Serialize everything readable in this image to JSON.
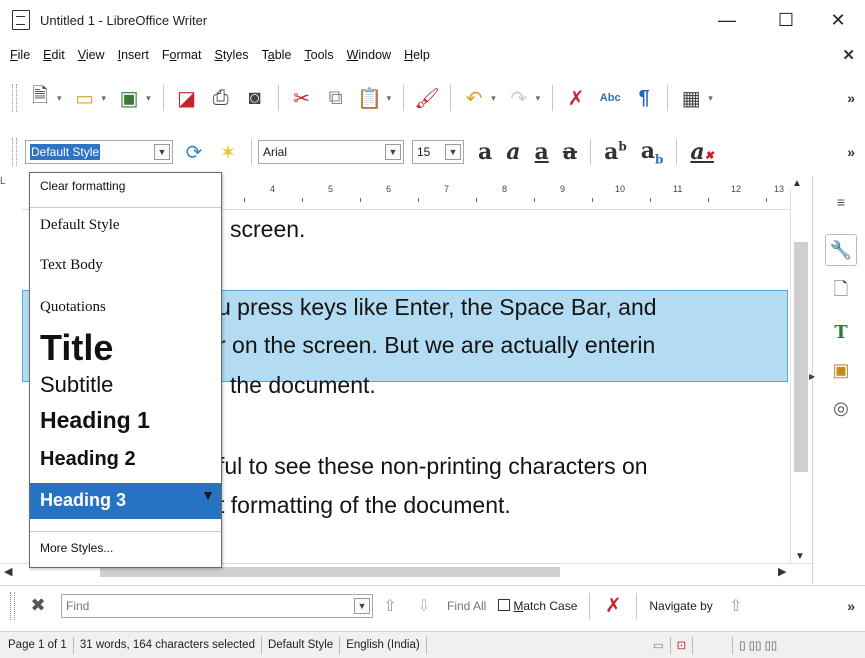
{
  "window": {
    "title": "Untitled 1 - LibreOffice Writer",
    "minimize": "—",
    "maximize": "☐",
    "close": "✕"
  },
  "menu": {
    "items": [
      {
        "u": "F",
        "rest": "ile"
      },
      {
        "u": "E",
        "rest": "dit"
      },
      {
        "u": "V",
        "rest": "iew"
      },
      {
        "u": "I",
        "rest": "nsert"
      },
      {
        "pre": "F",
        "u": "o",
        "rest": "rmat"
      },
      {
        "u": "S",
        "rest": "tyles"
      },
      {
        "pre": "T",
        "u": "a",
        "rest": "ble"
      },
      {
        "u": "T",
        "rest": "ools"
      },
      {
        "u": "W",
        "rest": "indow"
      },
      {
        "u": "H",
        "rest": "elp"
      }
    ],
    "close": "✕"
  },
  "formatting": {
    "style_value": "Default Style",
    "font_value": "Arial",
    "size_value": "15"
  },
  "ruler": {
    "left_marker": "L",
    "labels": [
      "4",
      "5",
      "6",
      "7",
      "8",
      "9",
      "10",
      "11",
      "12",
      "13"
    ]
  },
  "document": {
    "lines": [
      "screen.",
      "u press keys like Enter, the Space Bar, and",
      "r on the screen. But we are actually enterin",
      "the document.",
      "ful to see these non-printing characters on",
      "t formatting of the document."
    ]
  },
  "style_list": {
    "clear": "Clear formatting",
    "default": "Default Style",
    "text_body": "Text Body",
    "quotations": "Quotations",
    "title": "Title",
    "subtitle": "Subtitle",
    "heading1": "Heading 1",
    "heading2": "Heading 2",
    "heading3": "Heading 3",
    "more": "More Styles..."
  },
  "findbar": {
    "placeholder": "Find",
    "find_all": "Find All",
    "match_case_u": "M",
    "match_case_rest": "atch Case",
    "navigate_by": "Navigate by"
  },
  "status": {
    "page": "Page 1 of 1",
    "words": "31 words, 164 characters selected",
    "style": "Default Style",
    "language": "English (India)"
  },
  "colors": {
    "selection": "#b3dbf2",
    "accent": "#2573c2"
  }
}
